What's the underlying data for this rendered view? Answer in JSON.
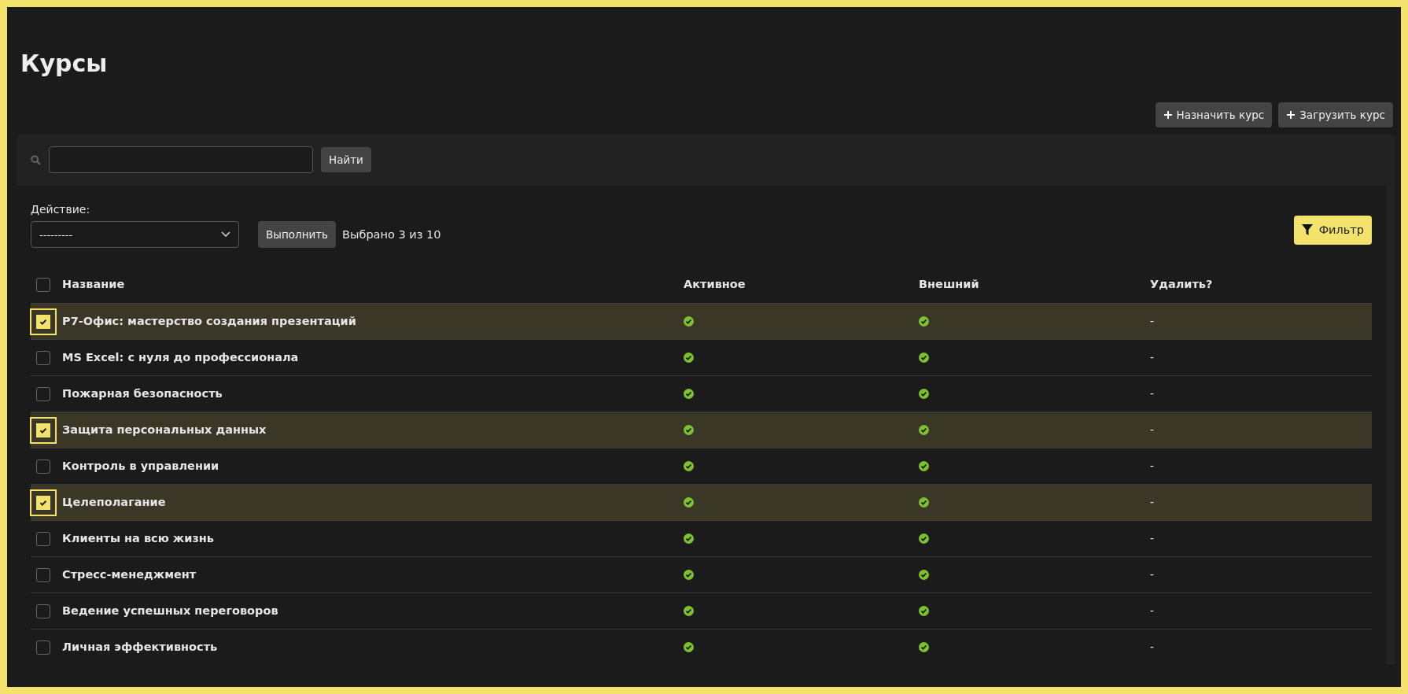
{
  "page_title": "Курсы",
  "header_buttons": [
    {
      "label": "Назначить курс"
    },
    {
      "label": "Загрузить курс"
    }
  ],
  "search": {
    "button": "Найти"
  },
  "action": {
    "label": "Действие:",
    "value": "---------",
    "button": "Выполнить",
    "selection_count": "Выбрано 3 из 10"
  },
  "filter_button": "Фильтр",
  "table": {
    "select_all_checked": false,
    "columns": [
      "Название",
      "Активное",
      "Внешний",
      "Удалить?"
    ],
    "rows": [
      {
        "name": "Р7-Офис: мастерство создания презентаций",
        "active": true,
        "external": true,
        "delete": "-",
        "selected": true
      },
      {
        "name": "MS Excel: с нуля до профессионала",
        "active": true,
        "external": true,
        "delete": "-",
        "selected": false
      },
      {
        "name": "Пожарная безопасность",
        "active": true,
        "external": true,
        "delete": "-",
        "selected": false
      },
      {
        "name": "Защита персональных данных",
        "active": true,
        "external": true,
        "delete": "-",
        "selected": true
      },
      {
        "name": "Контроль в управлении",
        "active": true,
        "external": true,
        "delete": "-",
        "selected": false
      },
      {
        "name": "Целеполагание",
        "active": true,
        "external": true,
        "delete": "-",
        "selected": true
      },
      {
        "name": "Клиенты на всю жизнь",
        "active": true,
        "external": true,
        "delete": "-",
        "selected": false
      },
      {
        "name": "Стресс-менеджмент",
        "active": true,
        "external": true,
        "delete": "-",
        "selected": false
      },
      {
        "name": "Ведение успешных переговоров",
        "active": true,
        "external": true,
        "delete": "-",
        "selected": false
      },
      {
        "name": "Личная эффективность",
        "active": true,
        "external": true,
        "delete": "-",
        "selected": false
      }
    ]
  }
}
